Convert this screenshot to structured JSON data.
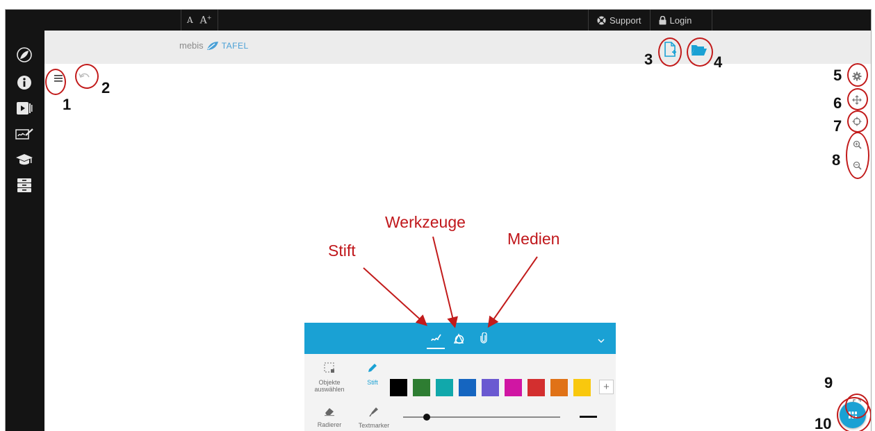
{
  "topbar": {
    "font_small": "A",
    "font_large": "A",
    "support_label": "Support",
    "login_label": "Login"
  },
  "brand": {
    "name": "mebis",
    "product": "TAFEL"
  },
  "sidebar": {
    "items": [
      {
        "icon": "mebis-leaf-icon"
      },
      {
        "icon": "info-icon"
      },
      {
        "icon": "media-icon"
      },
      {
        "icon": "signature-icon"
      },
      {
        "icon": "graduation-cap-icon"
      },
      {
        "icon": "archive-icon"
      }
    ]
  },
  "annotations": {
    "numbers": [
      "1",
      "2",
      "3",
      "4",
      "5",
      "6",
      "7",
      "8",
      "9",
      "10"
    ],
    "labels": {
      "stift": "Stift",
      "werkzeuge": "Werkzeuge",
      "medien": "Medien"
    }
  },
  "toolbar": {
    "tabs": [
      {
        "icon": "pen-icon",
        "active": true
      },
      {
        "icon": "shapes-icon",
        "active": false
      },
      {
        "icon": "paperclip-icon",
        "active": false
      }
    ],
    "tools": {
      "select_label": "Objekte auswählen",
      "pen_label": "Stift",
      "eraser_label": "Radierer",
      "marker_label": "Textmarker"
    },
    "colors": [
      "#000000",
      "#2e7d32",
      "#11a8ab",
      "#1565c0",
      "#6a59d1",
      "#d016a3",
      "#d32f2f",
      "#e07217",
      "#f9c80e"
    ],
    "add_color_label": "+",
    "stroke_level": 0.15
  },
  "theme": {
    "accent": "#1aa1d4",
    "annotation": "#c21b1b",
    "dark": "#141414"
  }
}
